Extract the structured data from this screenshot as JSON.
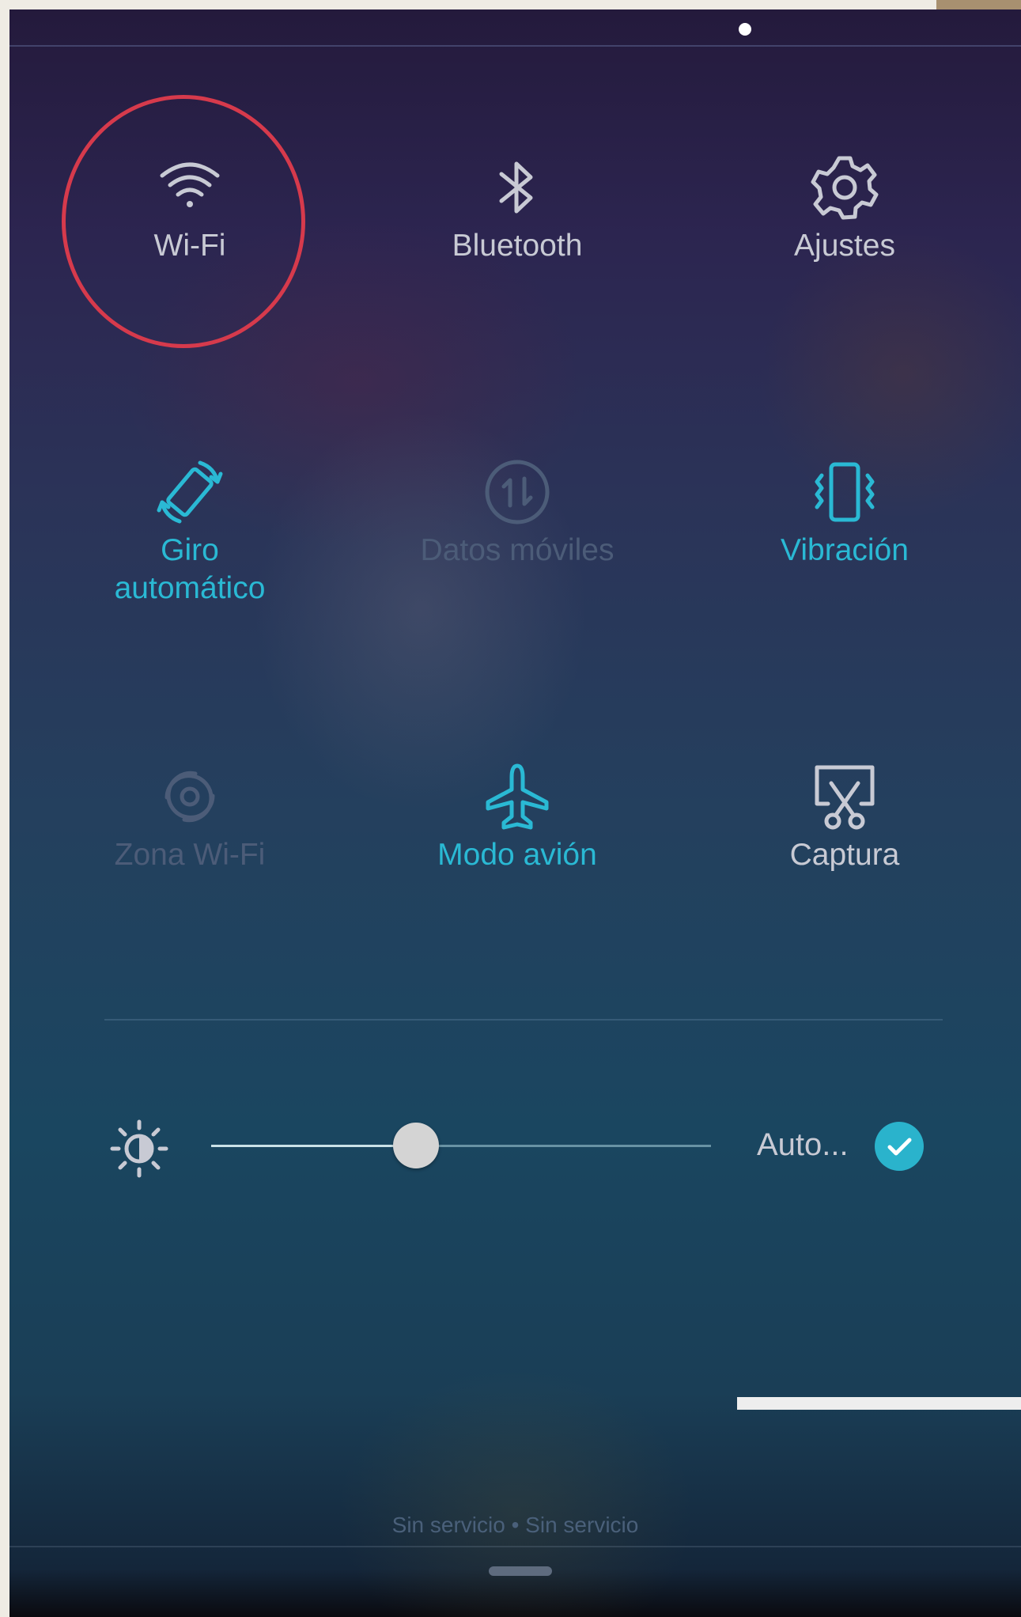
{
  "quick_settings": {
    "tiles": [
      {
        "id": "wifi",
        "label": "Wi-Fi",
        "icon": "wifi-icon",
        "state": "off",
        "highlighted": true
      },
      {
        "id": "bluetooth",
        "label": "Bluetooth",
        "icon": "bluetooth-icon",
        "state": "off"
      },
      {
        "id": "settings",
        "label": "Ajustes",
        "icon": "gear-icon",
        "state": "off"
      },
      {
        "id": "auto-rotate",
        "label": "Giro automático",
        "icon": "rotate-icon",
        "state": "on"
      },
      {
        "id": "mobile-data",
        "label": "Datos móviles",
        "icon": "mobile-data-icon",
        "state": "disabled"
      },
      {
        "id": "vibration",
        "label": "Vibración",
        "icon": "vibrate-icon",
        "state": "on"
      },
      {
        "id": "hotspot",
        "label": "Zona Wi-Fi",
        "icon": "hotspot-icon",
        "state": "disabled"
      },
      {
        "id": "airplane",
        "label": "Modo avión",
        "icon": "airplane-icon",
        "state": "on"
      },
      {
        "id": "screenshot",
        "label": "Captura",
        "icon": "screenshot-icon",
        "state": "off"
      }
    ]
  },
  "brightness": {
    "icon": "brightness-icon",
    "level": 0.41,
    "auto_label": "Auto...",
    "auto_checked": true
  },
  "status_text": "Sin servicio • Sin servicio",
  "colors": {
    "active": "#2ab9d4",
    "inactive": "#c8cad4",
    "disabled": "#4c5c78",
    "highlight_ring": "#d63a4c"
  }
}
